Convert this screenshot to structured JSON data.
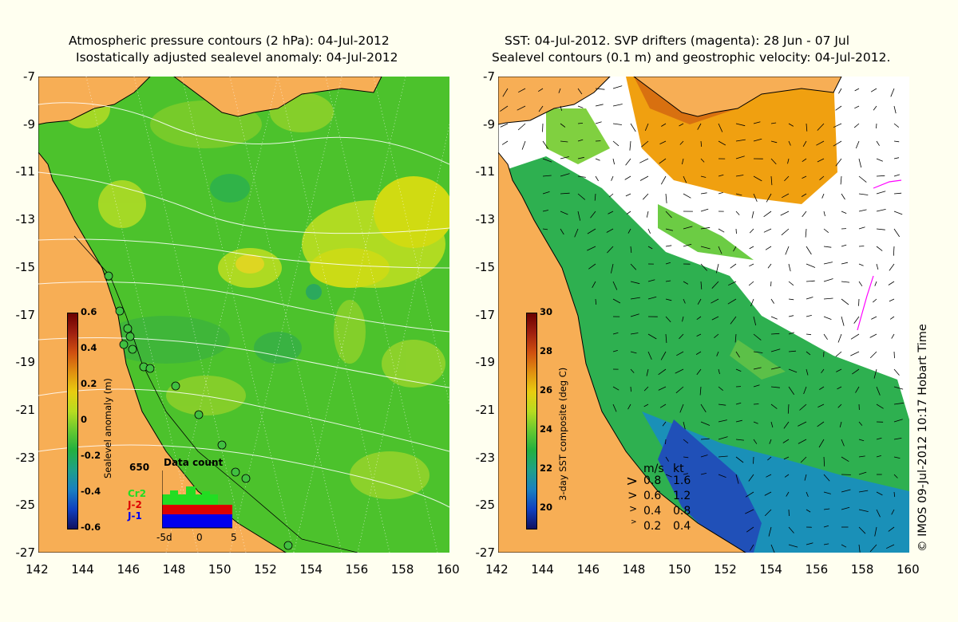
{
  "left_panel": {
    "title_line1": "Atmospheric pressure contours (2 hPa): 04-Jul-2012",
    "title_line2": "Isostatically adjusted sealevel anomaly: 04-Jul-2012",
    "colorbar": {
      "label": "Sealevel anomaly (m)",
      "ticks": [
        "0.6",
        "0.4",
        "0.2",
        "0",
        "-0.2",
        "-0.4",
        "-0.6"
      ],
      "range": [
        -0.6,
        0.6
      ]
    },
    "data_count": {
      "title": "Data count",
      "max_label": "650",
      "series": [
        {
          "name": "Cr2",
          "color": "#22dd22"
        },
        {
          "name": "J-2",
          "color": "#dd0000"
        },
        {
          "name": "J-1",
          "color": "#0000ee"
        }
      ],
      "x_ticks": [
        "-5d",
        "0",
        "5"
      ]
    }
  },
  "right_panel": {
    "title_line1": "SST: 04-Jul-2012. SVP drifters (magenta): 28 Jun - 07 Jul",
    "title_line2": "Sealevel contours (0.1 m) and geostrophic velocity: 04-Jul-2012.",
    "colorbar": {
      "label": "3-day SST composite (deg C)",
      "ticks": [
        "30",
        "28",
        "26",
        "24",
        "22",
        "20"
      ],
      "range": [
        19,
        30
      ]
    },
    "velocity_legend": {
      "header_ms": "m/s",
      "header_kt": "kt",
      "rows": [
        {
          "ms": "0.8",
          "kt": "1.6"
        },
        {
          "ms": "0.6",
          "kt": "1.2"
        },
        {
          "ms": "0.4",
          "kt": "0.8"
        },
        {
          "ms": "0.2",
          "kt": "0.4"
        }
      ]
    }
  },
  "axes": {
    "x_ticks": [
      "142",
      "144",
      "146",
      "148",
      "150",
      "152",
      "154",
      "156",
      "158",
      "160"
    ],
    "y_ticks": [
      "-7",
      "-9",
      "-11",
      "-13",
      "-15",
      "-17",
      "-19",
      "-21",
      "-23",
      "-25",
      "-27"
    ],
    "lon_range": [
      142,
      160
    ],
    "lat_range": [
      -27,
      -7
    ]
  },
  "credit": "© IMOS 09-Jul-2012 10:17 Hobart Time",
  "colors": {
    "land": "#f7ae55",
    "background": "#fffff0",
    "ssa_base": "#33bb22",
    "cloud": "#ffffff"
  }
}
